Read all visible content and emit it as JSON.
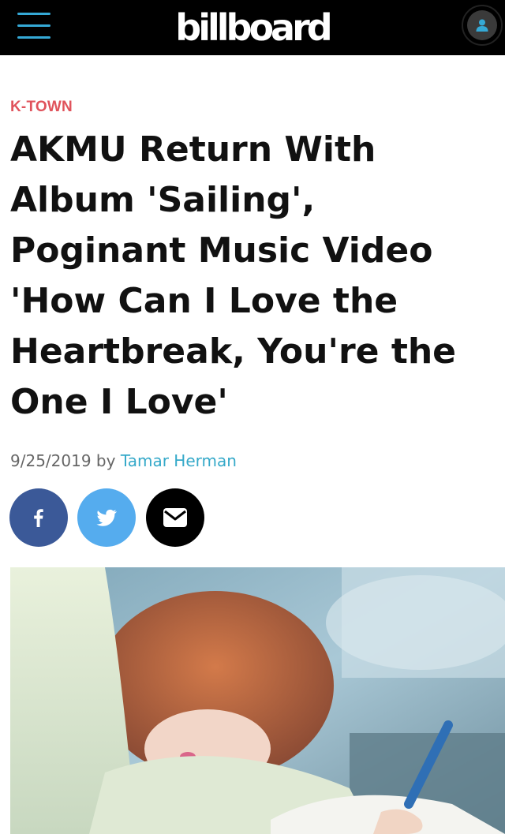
{
  "header": {
    "logo_text": "billboard",
    "menu_icon": "hamburger-menu-icon",
    "account_icon": "user-icon",
    "accent_color": "#35a9d6"
  },
  "article": {
    "category": "K-TOWN",
    "category_color": "#e0535c",
    "headline": "AKMU Return With Album 'Sailing', Poginant Music Video 'How Can I Love the Heartbreak, You're the One I Love'",
    "date": "9/25/2019",
    "by_label": "by",
    "author": "Tamar Herman",
    "author_color": "#35a9c9"
  },
  "share": [
    {
      "icon": "facebook-icon",
      "color": "#3b5998"
    },
    {
      "icon": "twitter-icon",
      "color": "#55acee"
    },
    {
      "icon": "email-icon",
      "color": "#000000"
    }
  ],
  "hero_image": {
    "icon": "article-hero-image"
  }
}
